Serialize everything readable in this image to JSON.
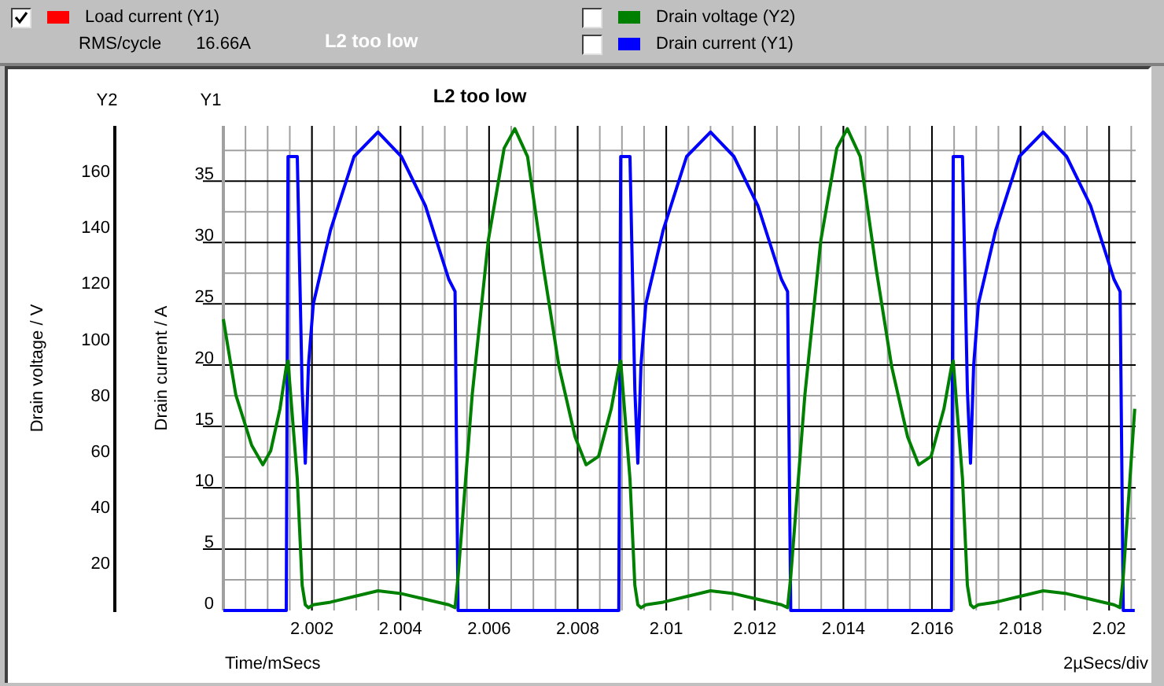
{
  "header": {
    "load_series": {
      "label": "Load current (Y1)",
      "color": "#ff0000",
      "checked": true,
      "rms_label": "RMS/cycle",
      "rms_value": "16.66A"
    },
    "status": "L2 too low",
    "series_toggles": [
      {
        "label": "Drain voltage (Y2)",
        "color": "#008000",
        "checked": false
      },
      {
        "label": "Drain current (Y1)",
        "color": "#0000ff",
        "checked": false
      }
    ]
  },
  "chart": {
    "y2_title": "Y2",
    "y1_title": "Y1",
    "scale_note": "2µSecs/div",
    "chart_data": {
      "type": "line",
      "title": "L2 too low",
      "xlabel": "Time/mSecs",
      "ylabel": "Drain current / A",
      "y2label": "Drain voltage / V",
      "grid": true,
      "xlim": [
        2,
        2.0206
      ],
      "ylim": [
        0,
        39.5
      ],
      "y2lim": [
        3,
        176
      ],
      "xticks": [
        {
          "value": 2.002,
          "label": "2.002"
        },
        {
          "value": 2.004,
          "label": "2.004"
        },
        {
          "value": 2.006,
          "label": "2.006"
        },
        {
          "value": 2.008,
          "label": "2.008"
        },
        {
          "value": 2.01,
          "label": "2.01"
        },
        {
          "value": 2.012,
          "label": "2.012"
        },
        {
          "value": 2.014,
          "label": "2.014"
        },
        {
          "value": 2.016,
          "label": "2.016"
        },
        {
          "value": 2.018,
          "label": "2.018"
        },
        {
          "value": 2.02,
          "label": "2.02"
        }
      ],
      "yticks": [
        0,
        5,
        10,
        15,
        20,
        25,
        30,
        35
      ],
      "y2ticks": [
        20,
        40,
        60,
        80,
        100,
        120,
        140,
        160
      ],
      "x": [
        2,
        2.00028,
        2.00064,
        2.00089,
        2.00107,
        2.00128,
        2.00142,
        2.00146,
        2.00167,
        2.00178,
        2.00185,
        2.00192,
        2.00203,
        2.00242,
        2.00295,
        2.00349,
        2.00402,
        2.00456,
        2.00509,
        2.00523,
        2.0053,
        2.00562,
        2.00598,
        2.00634,
        2.00658,
        2.00687,
        2.00723,
        2.00758,
        2.00794,
        2.00819,
        2.00847,
        2.00876,
        2.00893,
        2.00897,
        2.00918,
        2.00929,
        2.00936,
        2.00943,
        2.00954,
        2.00993,
        2.01046,
        2.011,
        2.01153,
        2.01207,
        2.0126,
        2.01274,
        2.01281,
        2.01313,
        2.01349,
        2.01385,
        2.01409,
        2.01438,
        2.01474,
        2.01509,
        2.01545,
        2.0157,
        2.01598,
        2.01627,
        2.01644,
        2.01648,
        2.01669,
        2.0168,
        2.01687,
        2.01694,
        2.01705,
        2.01744,
        2.01797,
        2.01851,
        2.01904,
        2.01958,
        2.02011,
        2.02025,
        2.02032,
        2.02058
      ],
      "series": [
        {
          "color": "#0000ff",
          "values": [
            0,
            0,
            0,
            0,
            0,
            0,
            0,
            37,
            37,
            18,
            12,
            20,
            25,
            31,
            37,
            39,
            37,
            33,
            27,
            26,
            0,
            0,
            0,
            0,
            0,
            0,
            0,
            0,
            0,
            0,
            0,
            0,
            0,
            37,
            37,
            18,
            12,
            20,
            25,
            31,
            37,
            39,
            37,
            33,
            27,
            26,
            0,
            0,
            0,
            0,
            0,
            0,
            0,
            0,
            0,
            0,
            0,
            0,
            0,
            37,
            37,
            18,
            12,
            20,
            25,
            31,
            37,
            39,
            37,
            33,
            27,
            26,
            0,
            0
          ]
        },
        {
          "axis": "y2",
          "color": "#008000",
          "values": [
            107,
            80,
            62,
            55,
            60,
            75,
            90,
            92,
            50,
            12,
            5,
            4,
            5,
            6,
            8,
            10,
            9,
            7,
            5,
            4,
            15,
            80,
            135,
            168,
            175,
            165,
            125,
            90,
            65,
            55,
            58,
            75,
            90,
            92,
            50,
            12,
            5,
            4,
            5,
            6,
            8,
            10,
            9,
            7,
            5,
            4,
            15,
            80,
            135,
            168,
            175,
            165,
            125,
            90,
            65,
            55,
            58,
            75,
            90,
            92,
            50,
            12,
            5,
            4,
            5,
            6,
            8,
            10,
            9,
            7,
            5,
            4,
            15,
            75
          ]
        }
      ]
    }
  }
}
